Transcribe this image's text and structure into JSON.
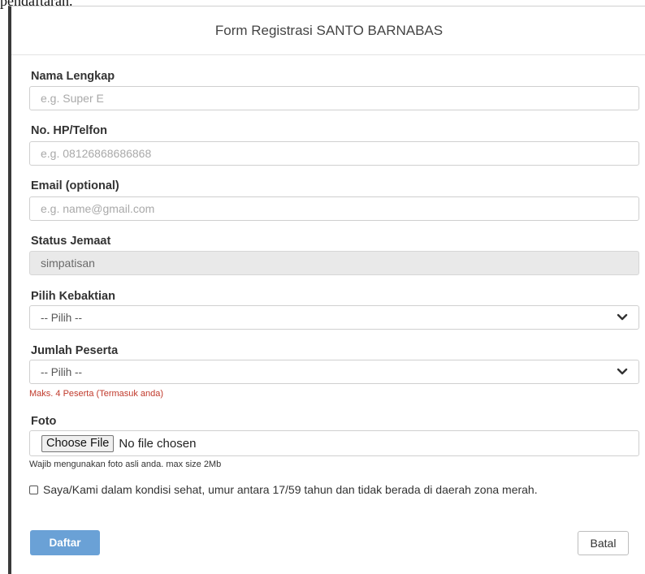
{
  "page": {
    "caption": "pendaftaran."
  },
  "modal": {
    "title": "Form Registrasi SANTO BARNABAS"
  },
  "form": {
    "name": {
      "label": "Nama Lengkap",
      "placeholder": "e.g. Super E",
      "value": ""
    },
    "phone": {
      "label": "No. HP/Telfon",
      "placeholder": "e.g. 08126868686868",
      "value": ""
    },
    "email": {
      "label": "Email (optional)",
      "placeholder": "e.g. name@gmail.com",
      "value": ""
    },
    "status": {
      "label": "Status Jemaat",
      "value": "simpatisan"
    },
    "service": {
      "label": "Pilih Kebaktian",
      "selected": "-- Pilih --"
    },
    "participants": {
      "label": "Jumlah Peserta",
      "selected": "-- Pilih --",
      "hint": "Maks. 4 Peserta (Termasuk anda)"
    },
    "photo": {
      "label": "Foto",
      "button_label": "Choose File",
      "status": "No file chosen",
      "hint": "Wajib mengunakan foto asli anda. max size 2Mb"
    },
    "consent": {
      "checked": false,
      "text": "Saya/Kami dalam kondisi sehat, umur antara 17/59 tahun dan tidak berada di daerah zona merah."
    }
  },
  "actions": {
    "submit_label": "Daftar",
    "cancel_label": "Batal"
  },
  "colors": {
    "primary": "#6aa1d6",
    "hint_red": "#c0392b",
    "readonly_bg": "#e9e9e9"
  }
}
